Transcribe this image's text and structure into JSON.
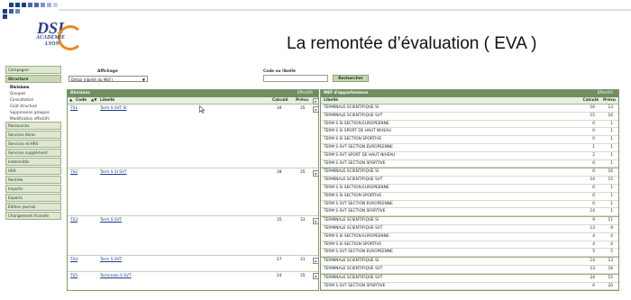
{
  "header": {
    "logo": {
      "line1": "DSI",
      "line2": "ACADÉMIE",
      "line3": "LYON"
    },
    "title": "La remontée d’évaluation ( EVA )",
    "colors": {
      "deco_blue": "#1f3f7a",
      "accent_green": "#6f8e5f"
    }
  },
  "sidebar": {
    "items": [
      {
        "label": "Campagne",
        "kind": "cat"
      },
      {
        "label": "Structure",
        "kind": "cat-active"
      },
      {
        "label": "Divisions",
        "kind": "item-selected"
      },
      {
        "label": "Groupes",
        "kind": "item"
      },
      {
        "label": "Consultation",
        "kind": "item"
      },
      {
        "label": "Coût structure",
        "kind": "item"
      },
      {
        "label": "Suppression groupes",
        "kind": "item"
      },
      {
        "label": "Modification effectifs",
        "kind": "item"
      },
      {
        "label": "Ressources",
        "kind": "cat"
      },
      {
        "label": "Services libres",
        "kind": "cat"
      },
      {
        "label": "Services et HRS",
        "kind": "cat"
      },
      {
        "label": "Services supplément",
        "kind": "cat"
      },
      {
        "label": "Indemnités",
        "kind": "cat"
      },
      {
        "label": "HSA",
        "kind": "cat"
      },
      {
        "label": "Rentrée",
        "kind": "cat"
      },
      {
        "label": "Imports",
        "kind": "cat"
      },
      {
        "label": "Exports",
        "kind": "cat"
      },
      {
        "label": "Édition journal",
        "kind": "cat"
      },
      {
        "label": "Changement d'année",
        "kind": "cat"
      }
    ]
  },
  "filters": {
    "affichage_label": "Affichage",
    "affichage_value": "Détail (libellé du MEF)",
    "code_label": "Code ou libellé",
    "search_button": "Rechercher"
  },
  "divisions": {
    "title": "Divisions",
    "effectifs_label": "Effectifs",
    "col_code": "Code",
    "col_libelle": "Libellé",
    "col_calcule": "Calculé",
    "col_prevu": "Prévu",
    "rows": [
      {
        "code": "TS1",
        "libelle": "Term S SVT SI",
        "calcule": "34",
        "prevu": "35"
      },
      {
        "code": "TS2",
        "libelle": "Term S SI SVT",
        "calcule": "28",
        "prevu": "35"
      },
      {
        "code": "TS3",
        "libelle": "Term S SVT",
        "calcule": "35",
        "prevu": "33"
      },
      {
        "code": "TS4",
        "libelle": "Term S SVT",
        "calcule": "27",
        "prevu": "31"
      },
      {
        "code": "TS5",
        "libelle": "Terminale S SVT",
        "calcule": "24",
        "prevu": "35"
      }
    ]
  },
  "mef": {
    "title": "MEF d'appartenance",
    "effectifs_label": "Effectifs",
    "col_libelle": "Libellé",
    "col_calcule": "Calculé",
    "col_prevu": "Prévu",
    "rows": [
      {
        "libelle": "TERMINALE SCIENTIFIQUE SI",
        "calcule": "16",
        "prevu": "13"
      },
      {
        "libelle": "TERMINALE SCIENTIFIQUE SVT",
        "calcule": "15",
        "prevu": "16"
      },
      {
        "libelle": "TERM S SI SECTION EUROPEENNE",
        "calcule": "0",
        "prevu": "1"
      },
      {
        "libelle": "TERM S SI SPORT DE HAUT NIVEAU",
        "calcule": "0",
        "prevu": "1"
      },
      {
        "libelle": "TERM S SI SECTION SPORTIVE",
        "calcule": "0",
        "prevu": "1"
      },
      {
        "libelle": "TERM S SVT SECTION EUROPEENNE",
        "calcule": "1",
        "prevu": "1"
      },
      {
        "libelle": "TERM S SVT SPORT DE HAUT NIVEAU",
        "calcule": "2",
        "prevu": "1"
      },
      {
        "libelle": "TERM S SVT SECTION SPORTIVE",
        "calcule": "0",
        "prevu": "1"
      },
      {
        "libelle": "TERMINALE SCIENTIFIQUE SI",
        "calcule": "0",
        "prevu": "16"
      },
      {
        "libelle": "TERMINALE SCIENTIFIQUE SVT",
        "calcule": "14",
        "prevu": "15"
      },
      {
        "libelle": "TERM S SI SECTION EUROPEENNE",
        "calcule": "0",
        "prevu": "1"
      },
      {
        "libelle": "TERM S SI SECTION SPORTIVE",
        "calcule": "0",
        "prevu": "1"
      },
      {
        "libelle": "TERM S SVT SECTION EUROPEENNE",
        "calcule": "0",
        "prevu": "1"
      },
      {
        "libelle": "TERM S SVT SECTION SPORTIVE",
        "calcule": "14",
        "prevu": "1"
      },
      {
        "libelle": "TERMINALE SCIENTIFIQUE SI",
        "calcule": "9",
        "prevu": "11"
      },
      {
        "libelle": "TERMINALE SCIENTIFIQUE SVT",
        "calcule": "13",
        "prevu": "9"
      },
      {
        "libelle": "TERM S SI SECTION EUROPEENNE",
        "calcule": "4",
        "prevu": "4"
      },
      {
        "libelle": "TERM S SI SECTION SPORTIVE",
        "calcule": "4",
        "prevu": "4"
      },
      {
        "libelle": "TERM S SVT SECTION EUROPEENNE",
        "calcule": "5",
        "prevu": "5"
      },
      {
        "libelle": "TERMINALE SCIENTIFIQUE SI",
        "calcule": "14",
        "prevu": "13"
      },
      {
        "libelle": "TERMINALE SCIENTIFIQUE SVT",
        "calcule": "13",
        "prevu": "18"
      },
      {
        "libelle": "TERMINALE SCIENTIFIQUE SVT",
        "calcule": "24",
        "prevu": "15"
      },
      {
        "libelle": "TERM S SVT SECTION SPORTIVE",
        "calcule": "0",
        "prevu": "20"
      }
    ]
  }
}
